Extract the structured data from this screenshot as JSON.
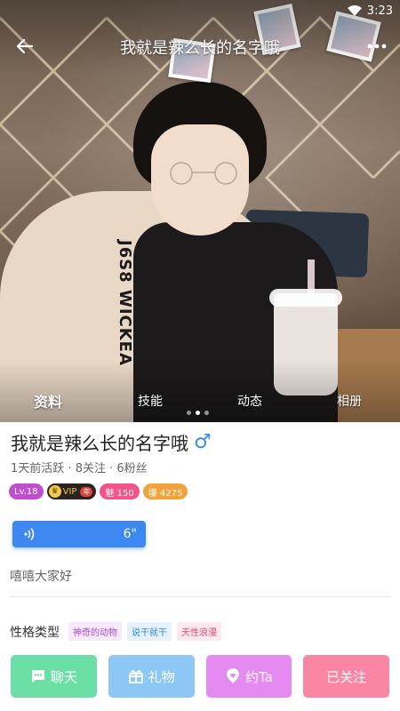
{
  "status_bar": {
    "time": "3:23",
    "icons": [
      "wifi-icon"
    ]
  },
  "header": {
    "title": "我就是辣么长的名字哦",
    "back_icon": "arrow-left-icon",
    "more_icon": "more-dots-icon"
  },
  "photo_tabs": [
    {
      "label": "资料",
      "active": true
    },
    {
      "label": "技能",
      "active": false
    },
    {
      "label": "动态",
      "active": false
    },
    {
      "label": "相册",
      "active": false
    }
  ],
  "carousel": {
    "count": 3,
    "current": 2
  },
  "profile": {
    "name": "我就是辣么长的名字哦",
    "gender_symbol": "♂",
    "activity": "1天前活跃",
    "following": "8关注",
    "fans": "6粉丝",
    "meta_separator": " · "
  },
  "badges": {
    "level": "Lv.18",
    "vip_label": "VIP",
    "vip_year": "年",
    "charm": "魅 150",
    "wealth": "壕 4275"
  },
  "voice": {
    "duration": "6\""
  },
  "bio": "嘻嘻大家好",
  "personality": {
    "label": "性格类型",
    "tags": [
      "神奇的动物",
      "说干就干",
      "天性浪漫"
    ]
  },
  "actions": {
    "chat": "聊天",
    "gift": "礼物",
    "date": "约Ta",
    "follow": "已关注"
  },
  "colors": {
    "chat": "#6bdfa6",
    "gift": "#8dc7f5",
    "date": "#e48af0",
    "follow": "#fb86a4",
    "voice": "#3d88f0",
    "male": "#3a8ee6"
  }
}
